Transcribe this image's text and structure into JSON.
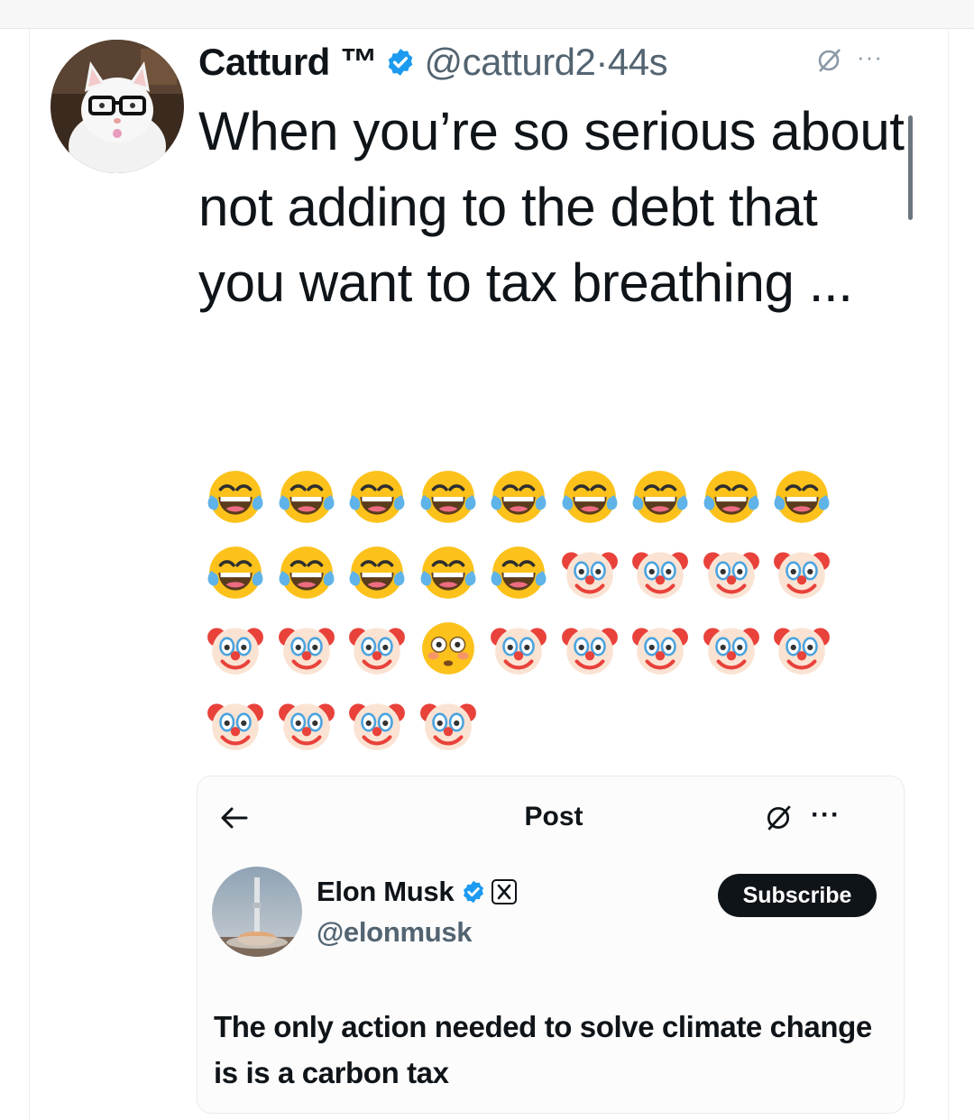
{
  "tweet": {
    "author_name": "Catturd ™",
    "handle": "@catturd2",
    "separator": "·",
    "time": "44s",
    "more": "···",
    "text": "When you’re so serious about not adding to the debt that you want to tax breathing ..."
  },
  "emoji_rows": [
    [
      "laughing-tears",
      "laughing-tears",
      "laughing-tears",
      "laughing-tears",
      "laughing-tears",
      "laughing-tears",
      "laughing-tears",
      "laughing-tears",
      "laughing-tears"
    ],
    [
      "laughing-tears",
      "laughing-tears",
      "laughing-tears",
      "laughing-tears",
      "laughing-tears",
      "clown",
      "clown",
      "clown",
      "clown"
    ],
    [
      "clown",
      "clown",
      "clown",
      "flushed",
      "clown",
      "clown",
      "clown",
      "clown",
      "clown"
    ],
    [
      "clown",
      "clown",
      "clown",
      "clown"
    ]
  ],
  "quote": {
    "title": "Post",
    "more": "···",
    "author_name": "Elon Musk",
    "handle": "@elonmusk",
    "subscribe_label": "Subscribe",
    "text": "The only action needed to solve climate change is is a carbon tax"
  },
  "colors": {
    "verified_blue": "#1d9bf0",
    "text": "#0f1419",
    "secondary": "#536471",
    "button_dark": "#0f1419"
  }
}
